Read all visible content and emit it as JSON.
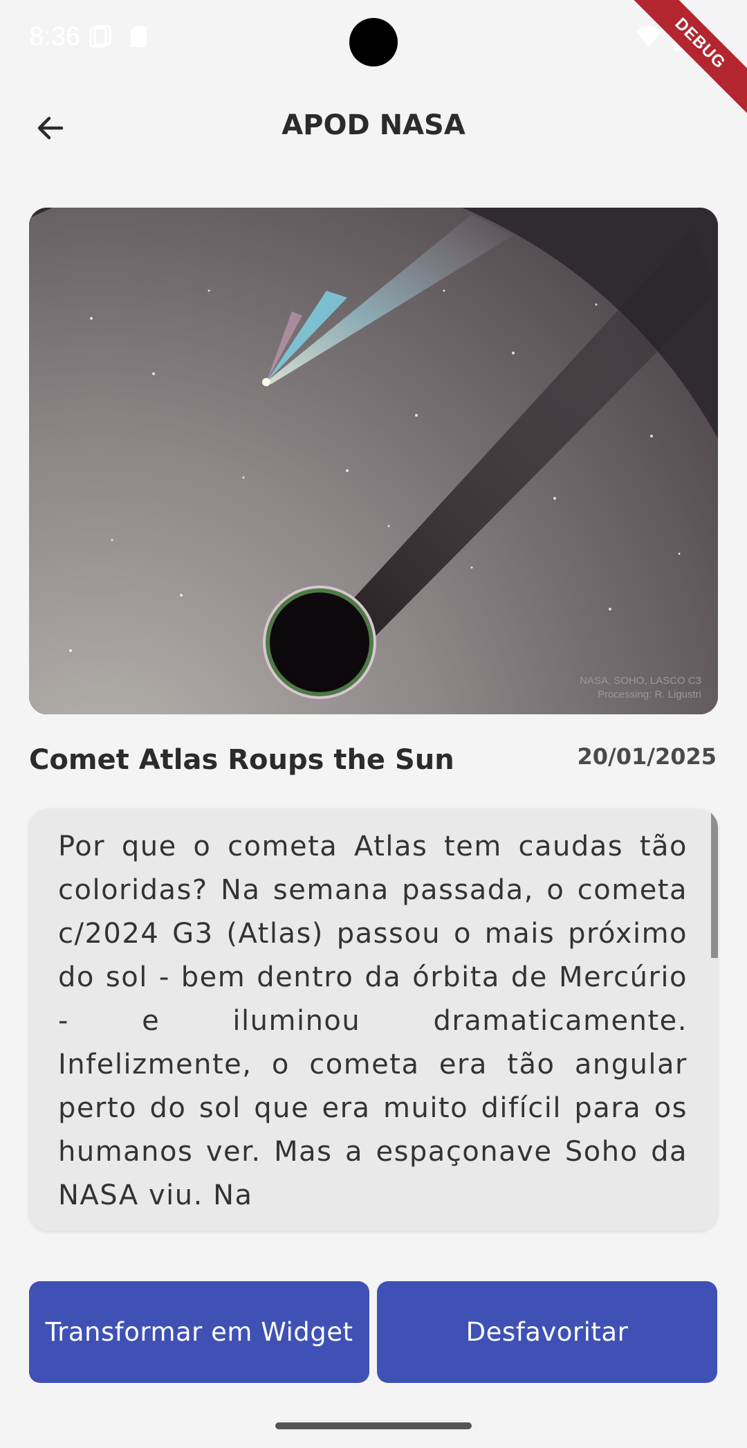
{
  "status_bar": {
    "time": "8:36",
    "icons": [
      "screen-icon",
      "sd-card-icon",
      "wifi-icon",
      "battery-icon"
    ]
  },
  "debug_banner": "DEBUG",
  "app_bar": {
    "title": "APOD NASA",
    "back_icon": "arrow-back-icon"
  },
  "apod": {
    "image_credit_line1": "NASA, SOHO, LASCO C3",
    "image_credit_line2": "Processing: R. Ligustri",
    "title": "Comet Atlas Roups the Sun",
    "date": "20/01/2025",
    "description": "Por que o cometa Atlas tem caudas tão coloridas? Na semana passada, o cometa c/2024 G3 (Atlas) passou o mais próximo do sol - bem dentro da órbita de Mercúrio - e iluminou dramaticamente. Infelizmente, o cometa era tão angular perto do sol que era muito difícil para os humanos ver. Mas a espaçonave Soho da NASA viu. Na"
  },
  "buttons": {
    "widget": "Transformar em Widget",
    "unfavorite": "Desfavoritar"
  },
  "colors": {
    "primary": "#3f51b5",
    "background": "#f4f4f4",
    "card": "#e9e9e9",
    "debug": "#b3262f"
  }
}
